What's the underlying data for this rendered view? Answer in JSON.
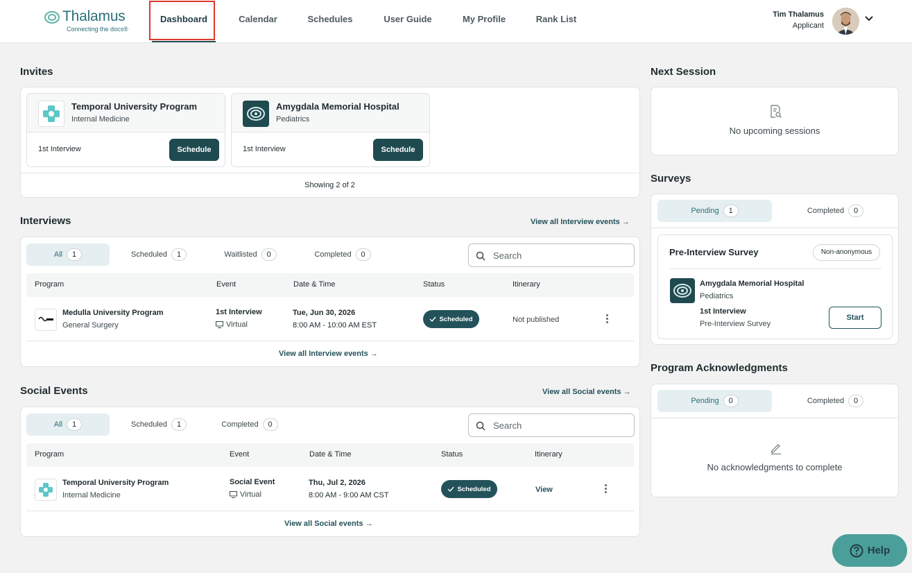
{
  "header": {
    "brand": "Thalamus",
    "tagline": "Connecting the docs®",
    "nav": [
      "Dashboard",
      "Calendar",
      "Schedules",
      "User Guide",
      "My Profile",
      "Rank List"
    ],
    "user_name": "Tim Thalamus",
    "user_role": "Applicant"
  },
  "invites": {
    "title": "Invites",
    "cards": [
      {
        "program": "Temporal University Program",
        "specialty": "Internal Medicine",
        "event": "1st Interview",
        "button": "Schedule"
      },
      {
        "program": "Amygdala Memorial Hospital",
        "specialty": "Pediatrics",
        "event": "1st Interview",
        "button": "Schedule"
      }
    ],
    "showing": "Showing 2 of 2"
  },
  "interviews": {
    "title": "Interviews",
    "view_all_top": "View all Interview events →",
    "tabs": [
      {
        "label": "All",
        "count": "1"
      },
      {
        "label": "Scheduled",
        "count": "1"
      },
      {
        "label": "Waitlisted",
        "count": "0"
      },
      {
        "label": "Completed",
        "count": "0"
      }
    ],
    "search_placeholder": "Search",
    "columns": [
      "Program",
      "Event",
      "Date & Time",
      "Status",
      "Itinerary"
    ],
    "rows": [
      {
        "program": "Medulla University Program",
        "specialty": "General Surgery",
        "event": "1st Interview",
        "mode": "Virtual",
        "date": "Tue, Jun 30, 2026",
        "time": "8:00 AM - 10:00 AM EST",
        "status": "Scheduled",
        "itinerary": "Not published"
      }
    ],
    "view_all_bottom": "View all Interview events →"
  },
  "social": {
    "title": "Social Events",
    "view_all_top": "View all Social events →",
    "tabs": [
      {
        "label": "All",
        "count": "1"
      },
      {
        "label": "Scheduled",
        "count": "1"
      },
      {
        "label": "Completed",
        "count": "0"
      }
    ],
    "search_placeholder": "Search",
    "columns": [
      "Program",
      "Event",
      "Date & Time",
      "Status",
      "Itinerary"
    ],
    "rows": [
      {
        "program": "Temporal University Program",
        "specialty": "Internal Medicine",
        "event": "Social Event",
        "mode": "Virtual",
        "date": "Thu, Jul 2, 2026",
        "time": "8:00 AM - 9:00 AM CST",
        "status": "Scheduled",
        "itinerary": "View"
      }
    ],
    "view_all_bottom": "View all Social events →"
  },
  "next_session": {
    "title": "Next Session",
    "empty": "No upcoming sessions"
  },
  "surveys": {
    "title": "Surveys",
    "tabs": [
      {
        "label": "Pending",
        "count": "1"
      },
      {
        "label": "Completed",
        "count": "0"
      }
    ],
    "item": {
      "title": "Pre-Interview Survey",
      "chip": "Non-anonymous",
      "program": "Amygdala Memorial Hospital",
      "specialty": "Pediatrics",
      "event": "1st Interview",
      "survey": "Pre-Interview Survey",
      "button": "Start"
    }
  },
  "acknowledgments": {
    "title": "Program Acknowledgments",
    "tabs": [
      {
        "label": "Pending",
        "count": "0"
      },
      {
        "label": "Completed",
        "count": "0"
      }
    ],
    "empty": "No acknowledgments to complete"
  },
  "help": {
    "label": "Help"
  },
  "colors": {
    "primary": "#1f4a50",
    "accent": "#2a6f78",
    "highlight_box": "#e0362b",
    "help_bg": "#4b9f9a"
  }
}
